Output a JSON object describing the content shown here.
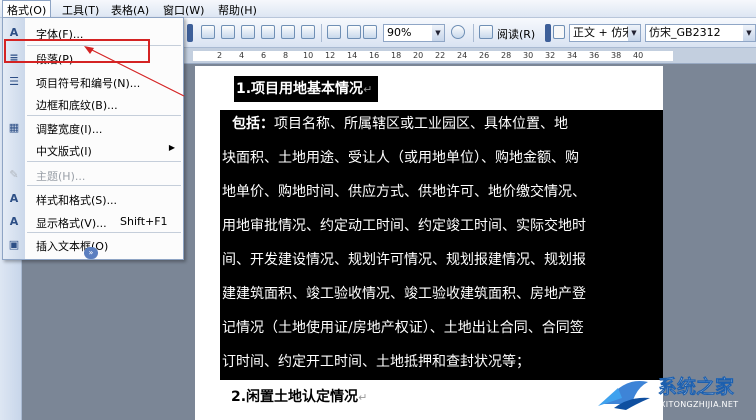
{
  "menubar": {
    "items": [
      "格式(O)",
      "工具(T)",
      "表格(A)",
      "窗口(W)",
      "帮助(H)"
    ]
  },
  "toolbar": {
    "zoom": "90%",
    "read_label": "阅读(R)",
    "style_box": "正文 + 仿宋",
    "font_box": "仿宋_GB2312"
  },
  "ruler": {
    "numbers": [
      "2",
      "4",
      "6",
      "8",
      "10",
      "12",
      "14",
      "16",
      "18",
      "20",
      "22",
      "24",
      "26",
      "28",
      "30",
      "32",
      "34",
      "36",
      "38",
      "40"
    ]
  },
  "format_menu": {
    "items": [
      {
        "icon": "A",
        "label": "字体(F)...",
        "shortcut": "",
        "submenu": false,
        "disabled": false
      },
      {
        "icon": "≡",
        "label": "段落(P)...",
        "shortcut": "",
        "submenu": false,
        "disabled": false
      },
      {
        "icon": "☰",
        "label": "项目符号和编号(N)...",
        "shortcut": "",
        "submenu": false,
        "disabled": false
      },
      {
        "icon": "",
        "label": "边框和底纹(B)...",
        "shortcut": "",
        "submenu": false,
        "disabled": false
      },
      {
        "icon": "▦",
        "label": "调整宽度(I)...",
        "shortcut": "",
        "submenu": false,
        "disabled": false
      },
      {
        "icon": "",
        "label": "中文版式(I)",
        "shortcut": "",
        "submenu": true,
        "disabled": false
      },
      {
        "icon": "✎",
        "label": "主题(H)...",
        "shortcut": "",
        "submenu": false,
        "disabled": true
      },
      {
        "icon": "A",
        "label": "样式和格式(S)...",
        "shortcut": "",
        "submenu": false,
        "disabled": false
      },
      {
        "icon": "A",
        "label": "显示格式(V)...",
        "shortcut": "Shift+F1",
        "submenu": false,
        "disabled": false
      },
      {
        "icon": "▣",
        "label": "插入文本框(O)",
        "shortcut": "",
        "submenu": false,
        "disabled": false
      }
    ],
    "expand_icon": "chevron-double-down-icon"
  },
  "document": {
    "heading1": "1.项目用地基本情况",
    "para_prefix": "包括：",
    "lines": [
      "项目名称、所属辖区或工业园区、具体位置、地",
      "块面积、土地用途、受让人（或用地单位）、购地金额、购",
      "地单价、购地时间、供应方式、供地许可、地价缴交情况、",
      "用地审批情况、约定动工时间、约定竣工时间、实际交地时",
      "间、开发建设情况、规划许可情况、规划报建情况、规划报",
      "建建筑面积、竣工验收情况、竣工验收建筑面积、房地产登",
      "记情况（土地使用证/房地产权证）、土地出让合同、合同签",
      "订时间、约定开工时间、土地抵押和查封状况等；"
    ],
    "heading2": "2.闲置土地认定情况",
    "para_mark": "↵"
  },
  "watermark": {
    "title": "系统之家",
    "url": "XITONGZHIJIA.NET"
  },
  "colors": {
    "highlight_box": "#d42323",
    "selection": "#000000"
  }
}
